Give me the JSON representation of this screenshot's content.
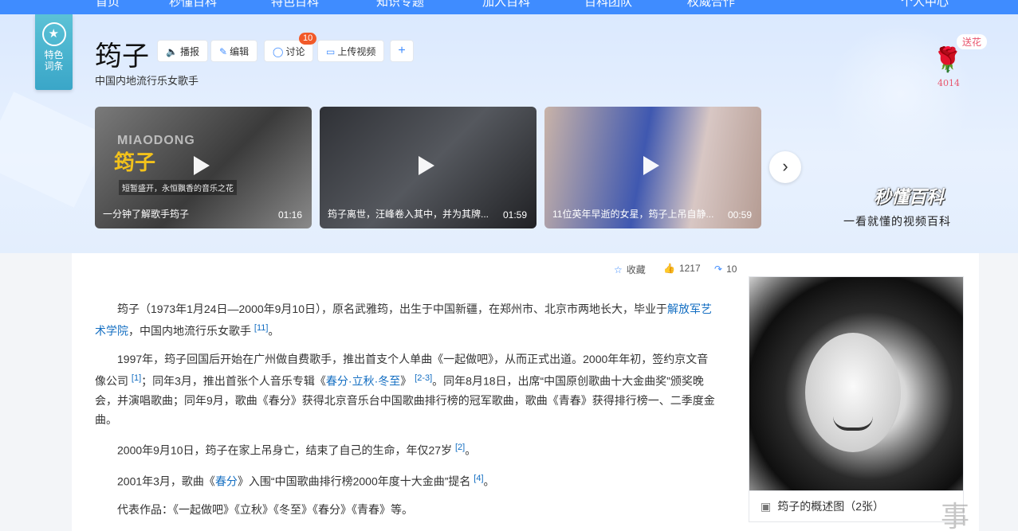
{
  "nav": {
    "items": [
      "首页",
      "秒懂百科",
      "特色百科",
      "知识专题",
      "加入百科",
      "百科团队",
      "权威合作",
      "个人中心"
    ]
  },
  "badge": {
    "line1": "特色",
    "line2": "词条"
  },
  "entry": {
    "title": "筠子",
    "subtitle": "中国内地流行乐女歌手",
    "buttons": {
      "broadcast": "播报",
      "edit": "编辑",
      "discuss": "讨论",
      "upload": "上传视频"
    },
    "discuss_count": "10",
    "plus": "+"
  },
  "flower": {
    "label": "送花",
    "count": "4014"
  },
  "videos": [
    {
      "title": "一分钟了解歌手筠子",
      "duration": "01:16",
      "mark": "MIAODONG",
      "name": "筠子",
      "tag": "短暂盛开，永恒飘香的音乐之花"
    },
    {
      "title": "筠子离世，汪峰卷入其中，并为其牌...",
      "duration": "01:59"
    },
    {
      "title": "11位英年早逝的女星，筠子上吊自静...",
      "duration": "00:59"
    }
  ],
  "brand": {
    "logo": "秒懂百科",
    "slogan": "一看就懂的视频百科"
  },
  "actions": {
    "favorite": "收藏",
    "likes": "1217",
    "shares": "10"
  },
  "paragraphs": {
    "p1": {
      "t1": "筠子（1973年1月24日—2000年9月10日），原名武雅筠，出生于中国新疆，在郑州市、北京市两地长大，毕业于",
      "link": "解放军艺术学院",
      "t2": "，中国内地流行乐女歌手",
      "ref": "[11]",
      "t3": "。"
    },
    "p2": {
      "t1": "1997年，筠子回国后开始在广州做自费歌手，推出首支个人单曲《一起做吧》，从而正式出道。2000年年初，签约京文音像公司",
      "ref1": "[1]",
      "t2": "；同年3月，推出首张个人音乐专辑《",
      "link": "春分·立秋·冬至",
      "t3": "》",
      "ref2": "[2-3]",
      "t4": "。同年8月18日，出席“中国原创歌曲十大金曲奖”颁奖晚会，并演唱歌曲；同年9月，歌曲《春分》获得北京音乐台中国歌曲排行榜的冠军歌曲，歌曲《青春》获得排行榜一、二季度金曲。"
    },
    "p3": {
      "t1": "2000年9月10日，筠子在家上吊身亡，结束了自己的生命，年仅27岁",
      "ref": "[2]",
      "t2": "。"
    },
    "p4": {
      "t1": "2001年3月，歌曲《",
      "link": "春分",
      "t2": "》入围“中国歌曲排行榜2000年度十大金曲”提名",
      "ref": "[4]",
      "t3": "。"
    },
    "p5": {
      "t1": "代表作品：《一起做吧》《立秋》《冬至》《春分》《青春》等。"
    }
  },
  "photo": {
    "caption": "筠子的概述图（2张）"
  },
  "watermark": "事"
}
